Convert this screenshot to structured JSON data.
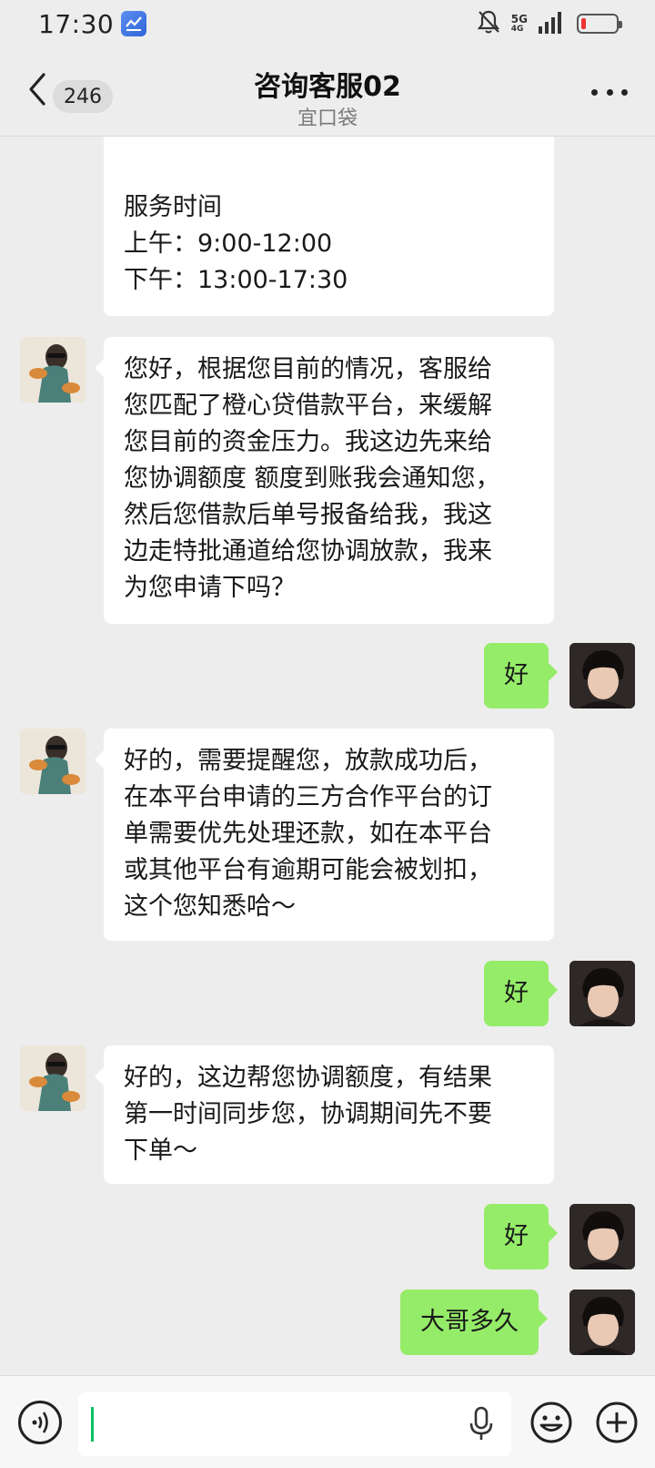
{
  "status_bar": {
    "time": "17:30",
    "network": "5G",
    "network_sub": "4G",
    "icons": [
      "app-notification-icon",
      "mute-bell-icon",
      "signal-icon",
      "battery-low-icon"
    ]
  },
  "header": {
    "unread_count": "246",
    "title": "咨询客服02",
    "subtitle": "宜口袋"
  },
  "messages": [
    {
      "side": "left",
      "sender": "agent",
      "text": "服务时间\n上午：9:00-12:00\n下午：13:00-17:30"
    },
    {
      "side": "left",
      "sender": "agent",
      "text": "您好，根据您目前的情况，客服给\n您匹配了橙心贷借款平台，来缓解\n您目前的资金压力。我这边先来给\n您协调额度 额度到账我会通知您，\n然后您借款后单号报备给我，我这\n边走特批通道给您协调放款，我来\n为您申请下吗？"
    },
    {
      "side": "right",
      "sender": "user",
      "text": "好"
    },
    {
      "side": "left",
      "sender": "agent",
      "text": "好的，需要提醒您，放款成功后，\n在本平台申请的三方合作平台的订\n单需要优先处理还款，如在本平台\n或其他平台有逾期可能会被划扣，\n这个您知悉哈～"
    },
    {
      "side": "right",
      "sender": "user",
      "text": "好"
    },
    {
      "side": "left",
      "sender": "agent",
      "text": "好的，这边帮您协调额度，有结果\n第一时间同步您，协调期间先不要\n下单～"
    },
    {
      "side": "right",
      "sender": "user",
      "text": "好"
    },
    {
      "side": "right",
      "sender": "user",
      "text": "大哥多久"
    }
  ],
  "input_bar": {
    "placeholder": "",
    "icons": [
      "voice-icon",
      "microphone-icon",
      "emoji-icon",
      "plus-icon"
    ]
  },
  "colors": {
    "background": "#ededed",
    "bubble_self": "#95ec69",
    "bubble_other": "#ffffff",
    "caret": "#07c160"
  }
}
